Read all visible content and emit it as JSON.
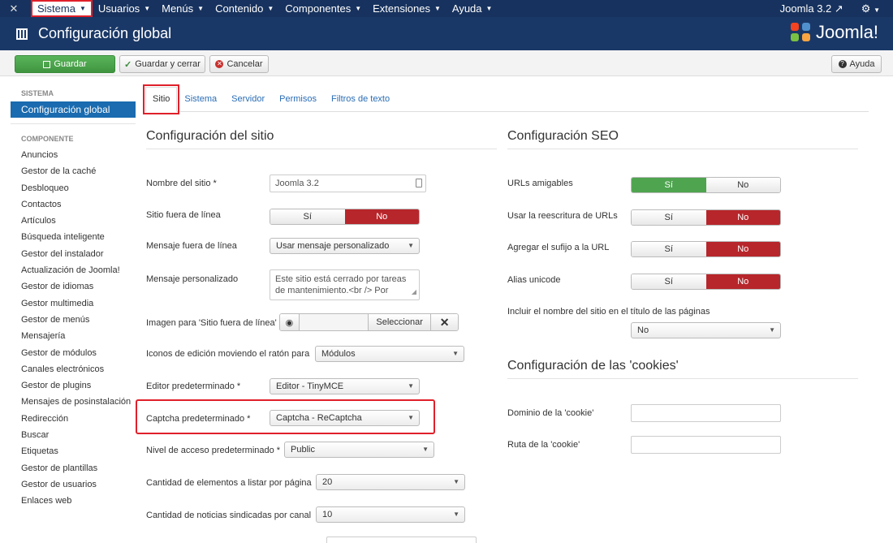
{
  "nav": {
    "items": [
      "Sistema",
      "Usuarios",
      "Menús",
      "Contenido",
      "Componentes",
      "Extensiones",
      "Ayuda"
    ],
    "site_link": "Joomla 3.2"
  },
  "header": {
    "title": "Configuración global",
    "brand": "Joomla!"
  },
  "toolbar": {
    "save": "Guardar",
    "save_close": "Guardar y cerrar",
    "cancel": "Cancelar",
    "help": "Ayuda"
  },
  "sidebar": {
    "system_heading": "SISTEMA",
    "active_item": "Configuración global",
    "component_heading": "COMPONENTE",
    "items": [
      "Anuncios",
      "Gestor de la caché",
      "Desbloqueo",
      "Contactos",
      "Artículos",
      "Búsqueda inteligente",
      "Gestor del instalador",
      "Actualización de Joomla!",
      "Gestor de idiomas",
      "Gestor multimedia",
      "Gestor de menús",
      "Mensajería",
      "Gestor de módulos",
      "Canales electrónicos",
      "Gestor de plugins",
      "Mensajes de posinstalación",
      "Redirección",
      "Buscar",
      "Etiquetas",
      "Gestor de plantillas",
      "Gestor de usuarios",
      "Enlaces web"
    ]
  },
  "tabs": [
    "Sitio",
    "Sistema",
    "Servidor",
    "Permisos",
    "Filtros de texto"
  ],
  "site": {
    "heading": "Configuración del sitio",
    "site_name_label": "Nombre del sitio *",
    "site_name_value": "Joomla 3.2",
    "offline_label": "Sitio fuera de línea",
    "offline_yes": "Sí",
    "offline_no": "No",
    "offline_msg_label": "Mensaje fuera de línea",
    "offline_msg_value": "Usar mensaje personalizado",
    "custom_msg_label": "Mensaje personalizado",
    "custom_msg_value": "Este sitio está cerrado por tareas de mantenimiento.<br /> Por",
    "offline_image_label": "Imagen para 'Sitio fuera de línea'",
    "offline_image_button": "Seleccionar",
    "hover_icons_label": "Iconos de edición moviendo el ratón para",
    "hover_icons_value": "Módulos",
    "editor_label": "Editor predeterminado *",
    "editor_value": "Editor - TinyMCE",
    "captcha_label": "Captcha predeterminado *",
    "captcha_value": "Captcha - ReCaptcha",
    "access_label": "Nivel de acceso predeterminado *",
    "access_value": "Public",
    "list_limit_label": "Cantidad de elementos a listar por página",
    "list_limit_value": "20",
    "feed_limit_label": "Cantidad de noticias sindicadas por canal",
    "feed_limit_value": "10"
  },
  "seo": {
    "heading": "Configuración SEO",
    "sef_label": "URLs amigables",
    "rewrite_label": "Usar la reescritura de URLs",
    "suffix_label": "Agregar el sufijo a la URL",
    "unicode_label": "Alias unicode",
    "yes": "Sí",
    "no": "No",
    "sitename_label": "Incluir el nombre del sitio en el título de las páginas",
    "sitename_value": "No"
  },
  "cookies": {
    "heading": "Configuración de las 'cookies'",
    "domain_label": "Dominio de la 'cookie'",
    "path_label": "Ruta de la 'cookie'"
  },
  "colors": {
    "nav": "#17325e",
    "accent_red": "#e0202a",
    "toggle_red": "#b7262b",
    "toggle_green": "#4fa44f",
    "link": "#2a6db5"
  }
}
